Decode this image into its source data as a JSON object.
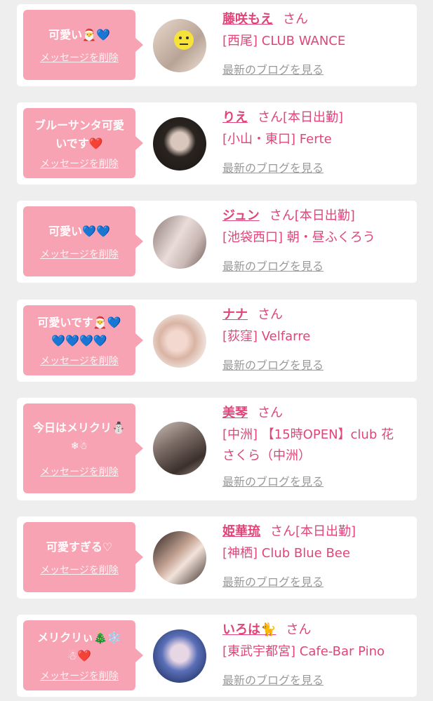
{
  "delete_label": "メッセージを削除",
  "blog_label": "最新のブログを見る",
  "cards": [
    {
      "message_line1": "可愛い🎅💙",
      "message_line2": "",
      "name": "藤咲もえ",
      "suffix": "さん",
      "shop": "[西尾] CLUB WANCE",
      "shop2": ""
    },
    {
      "message_line1": "ブルーサンタ可愛",
      "message_line2": "いです❤️",
      "name": "りえ",
      "suffix": "さん[本日出勤]",
      "shop": "[小山・東口] Ferte",
      "shop2": ""
    },
    {
      "message_line1": "可愛い💙💙",
      "message_line2": "",
      "name": "ジュン",
      "suffix": "さん[本日出勤]",
      "shop": "[池袋西口] 朝・昼ふくろう",
      "shop2": ""
    },
    {
      "message_line1": "可愛いです🎅💙",
      "message_line2": "💙💙💙💙",
      "name": "ナナ",
      "suffix": "さん",
      "shop": "[荻窪] Velfarre",
      "shop2": ""
    },
    {
      "message_line1": "今日はメリクリ⛄",
      "message_line2": "❄☃",
      "name": "美琴",
      "suffix": "さん",
      "shop": "[中洲] 【15時OPEN】club 花",
      "shop2": "さくら（中洲）"
    },
    {
      "message_line1": "可愛すぎる♡",
      "message_line2": "",
      "name": "姫華琉",
      "suffix": "さん[本日出勤]",
      "shop": "[神栖] Club Blue Bee",
      "shop2": ""
    },
    {
      "message_line1": "メリクリぃ🎄❄️",
      "message_line2": "☃❤️",
      "name": "いろは🐈",
      "suffix": "さん",
      "shop": "[東武宇都宮] Cafe-Bar Pino",
      "shop2": ""
    }
  ]
}
